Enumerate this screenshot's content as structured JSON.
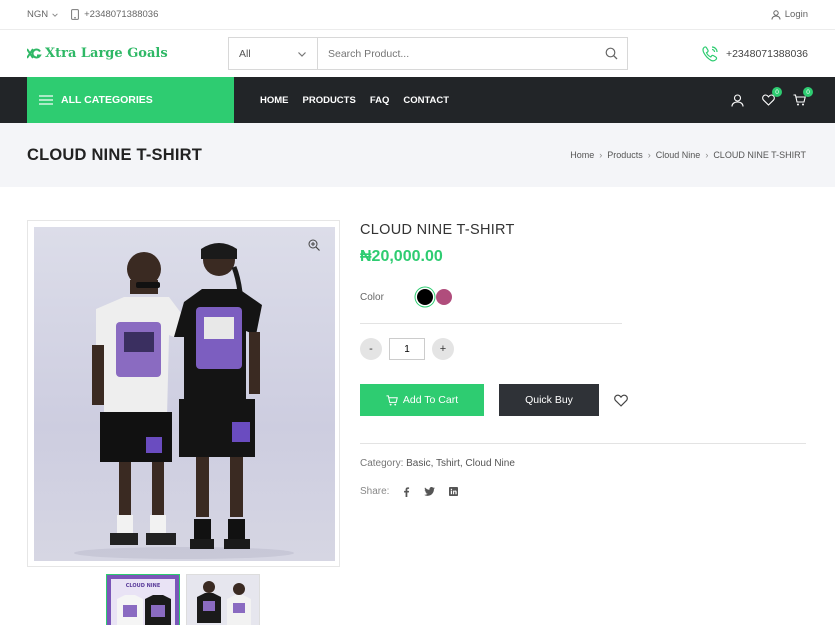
{
  "topbar": {
    "currency": "NGN",
    "phone": "+2348071388036",
    "login": "Login"
  },
  "header": {
    "logo_text": "Xtra Large Goals",
    "search_category": "All",
    "search_placeholder": "Search Product...",
    "phone": "+2348071388036"
  },
  "nav": {
    "all_categories": "ALL CATEGORIES",
    "menu": [
      "HOME",
      "PRODUCTS",
      "FAQ",
      "CONTACT"
    ],
    "wishlist_count": "0",
    "cart_count": "0"
  },
  "page": {
    "title": "CLOUD NINE T-SHIRT",
    "breadcrumb": [
      "Home",
      "Products",
      "Cloud Nine",
      "CLOUD NINE T-SHIRT"
    ]
  },
  "product": {
    "name": "CLOUD NINE T-SHIRT",
    "price": "₦20,000.00",
    "color_label": "Color",
    "colors": [
      "#000000",
      "#b04d7c"
    ],
    "quantity": "1",
    "minus": "-",
    "plus": "+",
    "add_to_cart": "Add To Cart",
    "quick_buy": "Quick Buy",
    "category_label": "Category:",
    "categories": "Basic, Tshirt, Cloud Nine",
    "share_label": "Share:",
    "thumb_label": "CLOUD NINE"
  },
  "theme": {
    "accent": "#2ecc71",
    "nav_bg": "#222528",
    "band_bg": "#f4f5f8"
  }
}
